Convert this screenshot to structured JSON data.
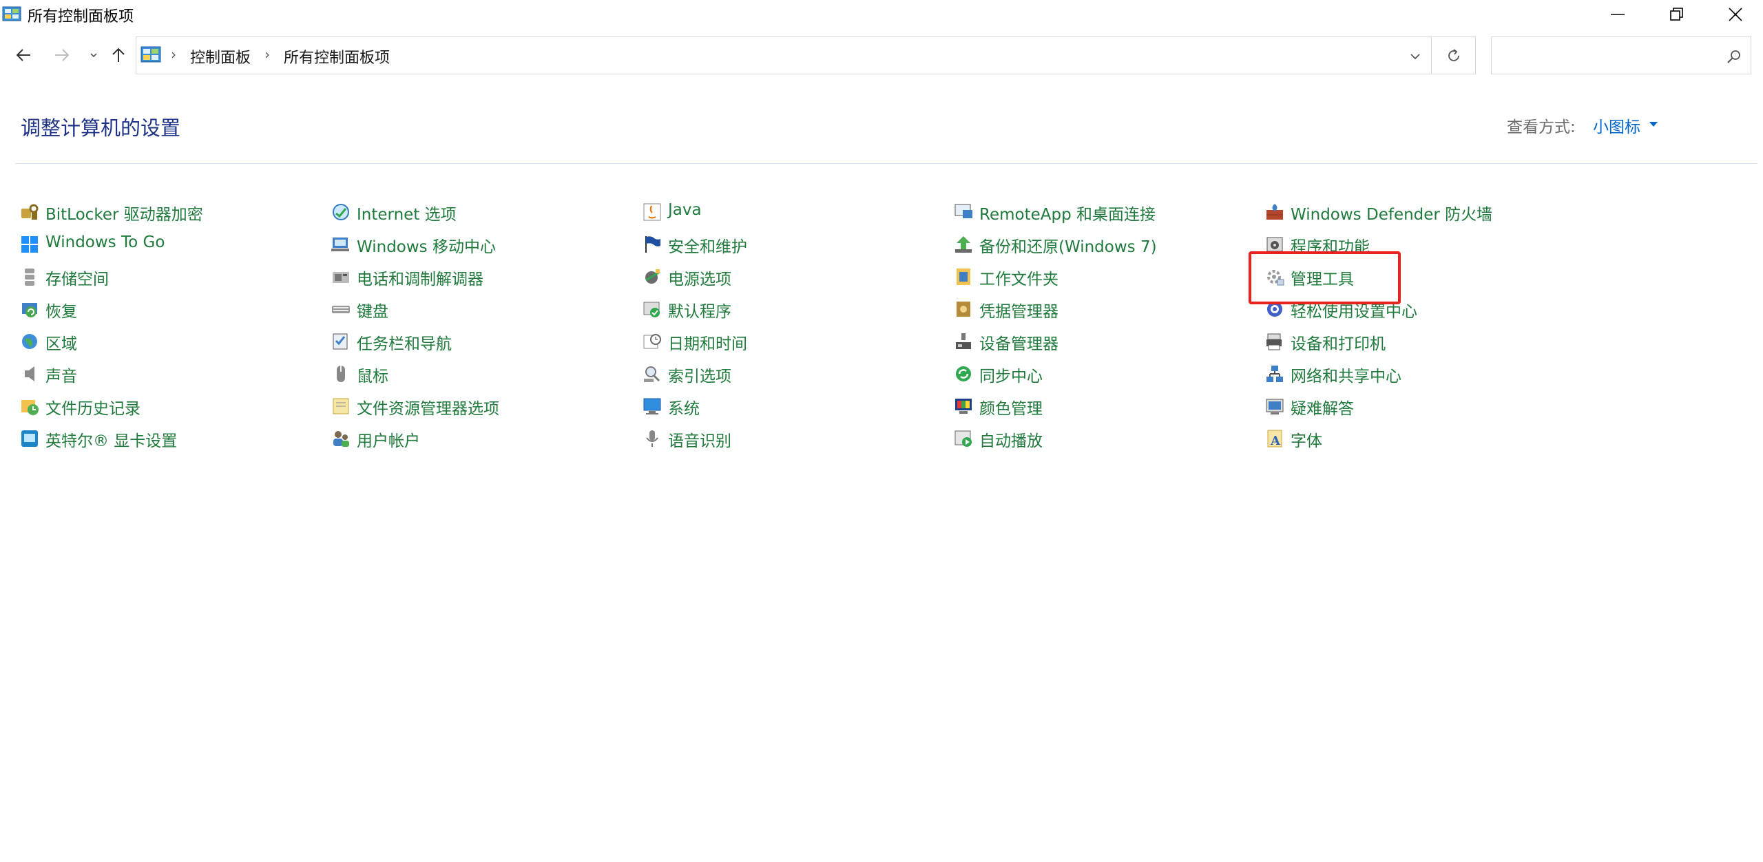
{
  "window": {
    "title": "所有控制面板项"
  },
  "address": {
    "crumbs": [
      "控制面板",
      "所有控制面板项"
    ],
    "search_placeholder": ""
  },
  "header": {
    "heading": "调整计算机的设置",
    "view_by_label": "查看方式:",
    "view_by_value": "小图标"
  },
  "columns": [
    {
      "items": [
        {
          "label": "BitLocker 驱动器加密",
          "icon": "bitlocker-icon"
        },
        {
          "label": "Windows To Go",
          "icon": "windows-to-go-icon"
        },
        {
          "label": "存储空间",
          "icon": "storage-spaces-icon"
        },
        {
          "label": "恢复",
          "icon": "recovery-icon"
        },
        {
          "label": "区域",
          "icon": "region-icon"
        },
        {
          "label": "声音",
          "icon": "sound-icon"
        },
        {
          "label": "文件历史记录",
          "icon": "file-history-icon"
        },
        {
          "label": "英特尔® 显卡设置",
          "icon": "intel-graphics-icon"
        }
      ]
    },
    {
      "items": [
        {
          "label": "Internet 选项",
          "icon": "internet-options-icon"
        },
        {
          "label": "Windows 移动中心",
          "icon": "mobility-center-icon"
        },
        {
          "label": "电话和调制解调器",
          "icon": "phone-modem-icon"
        },
        {
          "label": "键盘",
          "icon": "keyboard-icon"
        },
        {
          "label": "任务栏和导航",
          "icon": "taskbar-icon"
        },
        {
          "label": "鼠标",
          "icon": "mouse-icon"
        },
        {
          "label": "文件资源管理器选项",
          "icon": "folder-options-icon"
        },
        {
          "label": "用户帐户",
          "icon": "user-accounts-icon"
        }
      ]
    },
    {
      "items": [
        {
          "label": "Java",
          "icon": "java-icon"
        },
        {
          "label": "安全和维护",
          "icon": "security-flag-icon"
        },
        {
          "label": "电源选项",
          "icon": "power-options-icon"
        },
        {
          "label": "默认程序",
          "icon": "default-programs-icon"
        },
        {
          "label": "日期和时间",
          "icon": "date-time-icon"
        },
        {
          "label": "索引选项",
          "icon": "indexing-icon"
        },
        {
          "label": "系统",
          "icon": "system-icon"
        },
        {
          "label": "语音识别",
          "icon": "speech-recognition-icon"
        }
      ]
    },
    {
      "items": [
        {
          "label": "RemoteApp 和桌面连接",
          "icon": "remoteapp-icon"
        },
        {
          "label": "备份和还原(Windows 7)",
          "icon": "backup-restore-icon"
        },
        {
          "label": "工作文件夹",
          "icon": "work-folders-icon"
        },
        {
          "label": "凭据管理器",
          "icon": "credential-manager-icon"
        },
        {
          "label": "设备管理器",
          "icon": "device-manager-icon"
        },
        {
          "label": "同步中心",
          "icon": "sync-center-icon"
        },
        {
          "label": "颜色管理",
          "icon": "color-management-icon"
        },
        {
          "label": "自动播放",
          "icon": "autoplay-icon"
        }
      ]
    },
    {
      "items": [
        {
          "label": "Windows Defender 防火墙",
          "icon": "firewall-icon"
        },
        {
          "label": "程序和功能",
          "icon": "programs-features-icon"
        },
        {
          "label": "管理工具",
          "icon": "admin-tools-icon"
        },
        {
          "label": "轻松使用设置中心",
          "icon": "ease-of-access-icon"
        },
        {
          "label": "设备和打印机",
          "icon": "devices-printers-icon"
        },
        {
          "label": "网络和共享中心",
          "icon": "network-sharing-icon"
        },
        {
          "label": "疑难解答",
          "icon": "troubleshooting-icon"
        },
        {
          "label": "字体",
          "icon": "fonts-icon"
        }
      ]
    }
  ],
  "colors": {
    "link_green": "#1f7a3c",
    "heading_blue": "#1e3287",
    "accent_blue": "#0066cc",
    "highlight_red": "#e8221c"
  }
}
